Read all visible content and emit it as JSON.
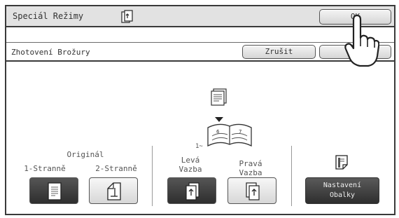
{
  "header": {
    "title": "Speciál Režimy",
    "ok_label": "OK"
  },
  "subheader": {
    "title": "Zhotovení Brožury",
    "cancel_label": "Zrušit"
  },
  "original": {
    "heading": "Originál",
    "one_sided_label": "1-Stranně",
    "two_sided_label": "2-Stranně"
  },
  "binding": {
    "start_page": "1~",
    "left_label_line1": "Levá",
    "left_label_line2": "Vazba",
    "right_label_line1": "Pravá",
    "right_label_line2": "Vazba"
  },
  "cover": {
    "button_line1": "Nastavení",
    "button_line2": "Obalky"
  },
  "icons": [
    "copy-icon",
    "document-icon",
    "booklet-icon",
    "cover-icon",
    "hand-pointer-icon"
  ],
  "colors": {
    "dark_button": "#3a3a3a",
    "light_button": "#e6e6e6",
    "frame": "#3a3a3a"
  }
}
